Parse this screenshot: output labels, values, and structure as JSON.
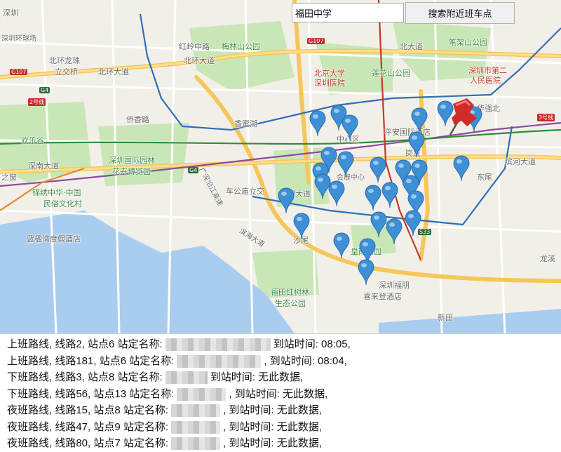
{
  "search": {
    "value": "福田中学",
    "button_label": "搜索附近班车点"
  },
  "map": {
    "labels": [
      {
        "text": "深圳",
        "cls": "dark"
      },
      {
        "text": "深圳环球场",
        "cls": "dark"
      },
      {
        "text": "红岭中路",
        "cls": "dark"
      },
      {
        "text": "梅林山公园",
        "cls": "green"
      },
      {
        "text": "笔架山公园",
        "cls": "green"
      },
      {
        "text": "北环大道",
        "cls": "dark"
      },
      {
        "text": "北环大道",
        "cls": "dark"
      },
      {
        "text": "北大道",
        "cls": "dark"
      },
      {
        "text": "北环龙珠",
        "cls": "dark"
      },
      {
        "text": "立交桥",
        "cls": "dark"
      },
      {
        "text": "北京大学",
        "cls": "red"
      },
      {
        "text": "深圳医院",
        "cls": "red"
      },
      {
        "text": "莲花山公园",
        "cls": "green"
      },
      {
        "text": "深圳市第二",
        "cls": "red"
      },
      {
        "text": "人民医院",
        "cls": "red"
      },
      {
        "text": "华强北",
        "cls": "dark"
      },
      {
        "text": "侨香路",
        "cls": "dark"
      },
      {
        "text": "香蜜湖",
        "cls": "dark"
      },
      {
        "text": "欢乐谷",
        "cls": "green"
      },
      {
        "text": "深圳国际园林",
        "cls": "green"
      },
      {
        "text": "花卉博览园",
        "cls": "green"
      },
      {
        "text": "深南大道",
        "cls": "dark"
      },
      {
        "text": "锦绣中华·中国",
        "cls": "green"
      },
      {
        "text": "民俗文化村",
        "cls": "green"
      },
      {
        "text": "车公庙立交",
        "cls": "dark"
      },
      {
        "text": "平安国际酒店",
        "cls": "dark"
      },
      {
        "text": "岗厦",
        "cls": "dark"
      },
      {
        "text": "东尾",
        "cls": "dark"
      },
      {
        "text": "滨河大道",
        "cls": "dark"
      },
      {
        "text": "蓝楹湾度假酒店",
        "cls": "dark"
      },
      {
        "text": "沙尾",
        "cls": "dark"
      },
      {
        "text": "深圳福朋",
        "cls": "dark"
      },
      {
        "text": "喜来登酒店",
        "cls": "dark"
      },
      {
        "text": "福田红树林",
        "cls": "green"
      },
      {
        "text": "生态公园",
        "cls": "green"
      },
      {
        "text": "新田",
        "cls": "dark"
      },
      {
        "text": "龙溪",
        "cls": "dark"
      },
      {
        "text": "皇岗公园",
        "cls": "green"
      },
      {
        "text": "广深沿江高速",
        "cls": "dark"
      },
      {
        "text": "滨海大道",
        "cls": "dark"
      },
      {
        "text": "之窗",
        "cls": "dark"
      },
      {
        "text": "河大道",
        "cls": "dark"
      },
      {
        "text": "中心区",
        "cls": "dark"
      },
      {
        "text": "会展中心",
        "cls": "dark"
      }
    ],
    "shields": [
      "G107",
      "G4",
      "G107",
      "G4",
      "2号线",
      "3号线",
      "S33"
    ]
  },
  "results": [
    {
      "prefix": "上班路线, 线路2, 站点6 站定名称:",
      "suffix": "到站时间: 08:05,"
    },
    {
      "prefix": "上班路线, 线路181, 站点6 站定名称:",
      "suffix": ", 到站时间: 08:04,"
    },
    {
      "prefix": "下班路线, 线路3, 站点8 站定名称:",
      "suffix": "到站时间: 无此数据,"
    },
    {
      "prefix": "下班路线, 线路56, 站点13 站定名称:",
      "suffix": ", 到站时间: 无此数据,"
    },
    {
      "prefix": "夜班路线, 线路15, 站点8 站定名称:",
      "suffix": ", 到站时间: 无此数据,"
    },
    {
      "prefix": "夜班路线, 线路47, 站点9 站定名称:",
      "suffix": ", 到站时间: 无此数据,"
    },
    {
      "prefix": "夜班路线, 线路80, 站点7 站定名称:",
      "suffix": ", 到站时间: 无此数据,"
    }
  ],
  "colors": {
    "pin": "#3d8fd6",
    "target_pin": "#d12b2b",
    "water": "#a9cdee",
    "park": "#c5e5b4"
  }
}
